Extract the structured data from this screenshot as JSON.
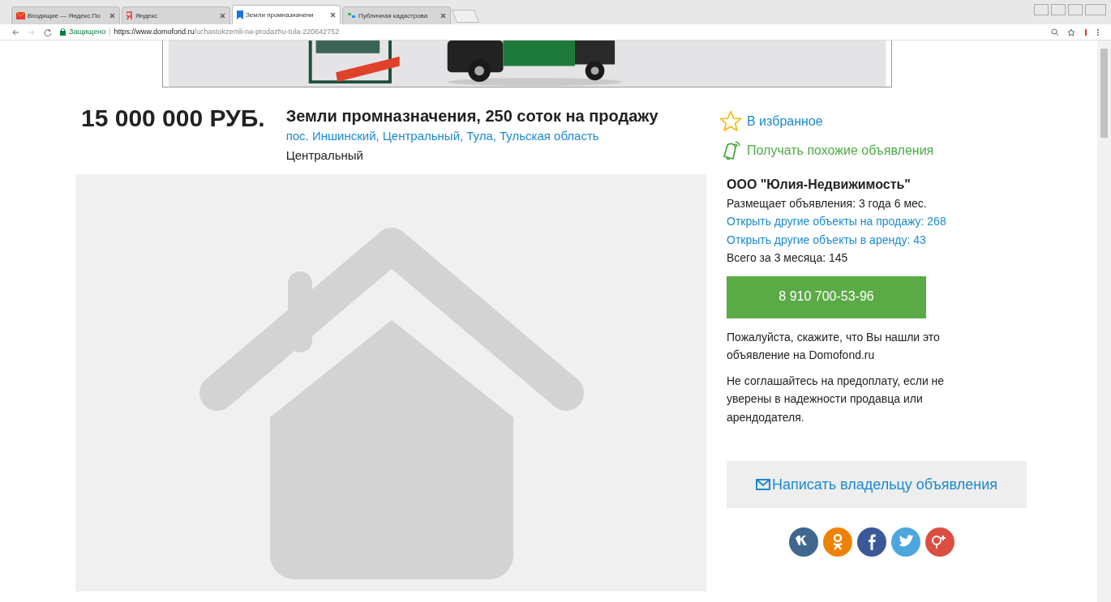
{
  "browser": {
    "tabs": [
      {
        "title": "Входящие — Яндекс.По",
        "kind": "mail",
        "selected": false
      },
      {
        "title": "Яндекс",
        "kind": "yandex",
        "selected": false
      },
      {
        "title": "Земли промназначени",
        "kind": "bookmark",
        "selected": true
      },
      {
        "title": "Публичная кадастрова",
        "kind": "map",
        "selected": false
      }
    ],
    "security": "Защищено",
    "separator": "|",
    "url_host": "https://www.domofond.ru",
    "url_path": "/uchastokzemli-na-prodazhu-tula-220642752"
  },
  "listing": {
    "location_separator": ",",
    "price": "15 000 000 РУБ.",
    "title": "Земли промназначения, 250 соток на продажу",
    "location_links": [
      "пос. Иншинский",
      "Центральный",
      "Тула",
      "Тульская область"
    ],
    "district": "Центральный"
  },
  "actions": [
    {
      "label": "В избранное",
      "kind": "star"
    },
    {
      "label": "Получать похожие объявления",
      "kind": "bell"
    }
  ],
  "seller": {
    "name": "ООО \"Юлия-Недвижимость\"",
    "tenure": "Размещает объявления: 3 года 6 мес.",
    "links": [
      "Открыть другие объекты на продажу: 268",
      "Открыть другие объекты в аренду: 43"
    ],
    "total": "Всего за 3 месяца: 145"
  },
  "phone_button": "8 910 700-53-96",
  "notes": [
    "Пожалуйста, скажите, что Вы нашли это объявление на Domofond.ru",
    "Не соглашайтесь на предоплату, если не уверены в надежности продавца или арендодателя."
  ],
  "message_button": "Написать владельцу объявления",
  "social": [
    {
      "kind": "vk",
      "color": "#41678f"
    },
    {
      "kind": "ok",
      "color": "#ee8208"
    },
    {
      "kind": "facebook",
      "color": "#3b5998"
    },
    {
      "kind": "twitter",
      "color": "#4da7de"
    },
    {
      "kind": "gplus",
      "color": "#dc4e41"
    }
  ]
}
